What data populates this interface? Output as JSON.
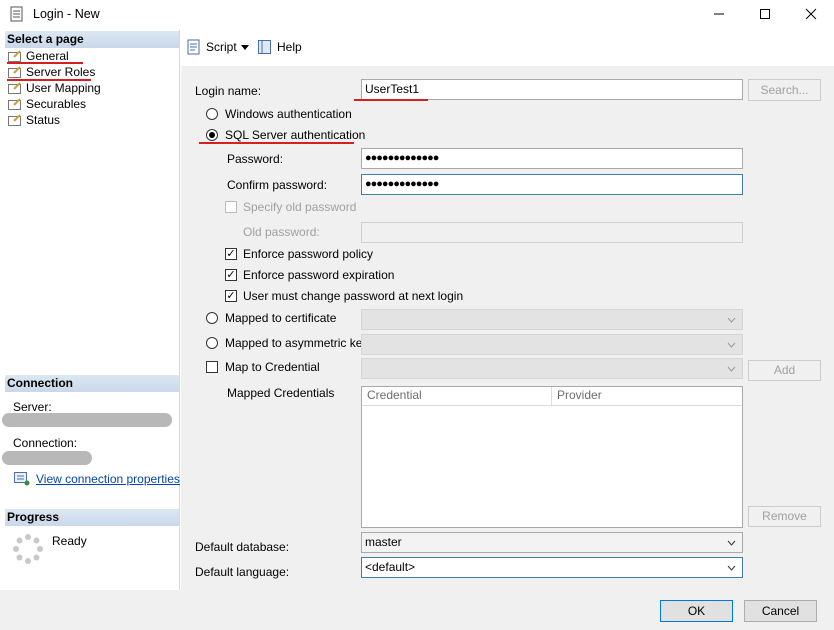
{
  "window": {
    "title": "Login - New",
    "minimize_icon": "minimize-icon",
    "maximize_icon": "maximize-icon",
    "close_icon": "close-icon"
  },
  "left": {
    "select_page_header": "Select a page",
    "pages": [
      {
        "label": "General"
      },
      {
        "label": "Server Roles"
      },
      {
        "label": "User Mapping"
      },
      {
        "label": "Securables"
      },
      {
        "label": "Status"
      }
    ],
    "connection_header": "Connection",
    "server_label": "Server:",
    "connection_label": "Connection:",
    "view_connection_link": "View connection properties",
    "progress_header": "Progress",
    "progress_status": "Ready"
  },
  "toolbar": {
    "script_label": "Script",
    "help_label": "Help"
  },
  "form": {
    "login_name_label": "Login name:",
    "login_name_value": "UserTest1",
    "search_button": "Search...",
    "windows_auth_label": "Windows authentication",
    "sql_auth_label": "SQL Server authentication",
    "password_label": "Password:",
    "password_value": "●●●●●●●●●●●●●",
    "confirm_password_label": "Confirm password:",
    "confirm_password_value": "●●●●●●●●●●●●●",
    "specify_old_password_label": "Specify old password",
    "old_password_label": "Old password:",
    "enforce_policy_label": "Enforce password policy",
    "enforce_expiration_label": "Enforce password expiration",
    "must_change_label": "User must change password at next login",
    "mapped_cert_label": "Mapped to certificate",
    "mapped_asym_label": "Mapped to asymmetric key",
    "map_credential_label": "Map to Credential",
    "add_button": "Add",
    "mapped_credentials_label": "Mapped Credentials",
    "credential_col": "Credential",
    "provider_col": "Provider",
    "remove_button": "Remove",
    "default_database_label": "Default database:",
    "default_database_value": "master",
    "default_language_label": "Default language:",
    "default_language_value": "<default>"
  },
  "footer": {
    "ok_button": "OK",
    "cancel_button": "Cancel"
  },
  "colors": {
    "annotation_red": "#d42020",
    "focus_blue": "#3c7fb1",
    "section_header": "#c9d8ea"
  }
}
